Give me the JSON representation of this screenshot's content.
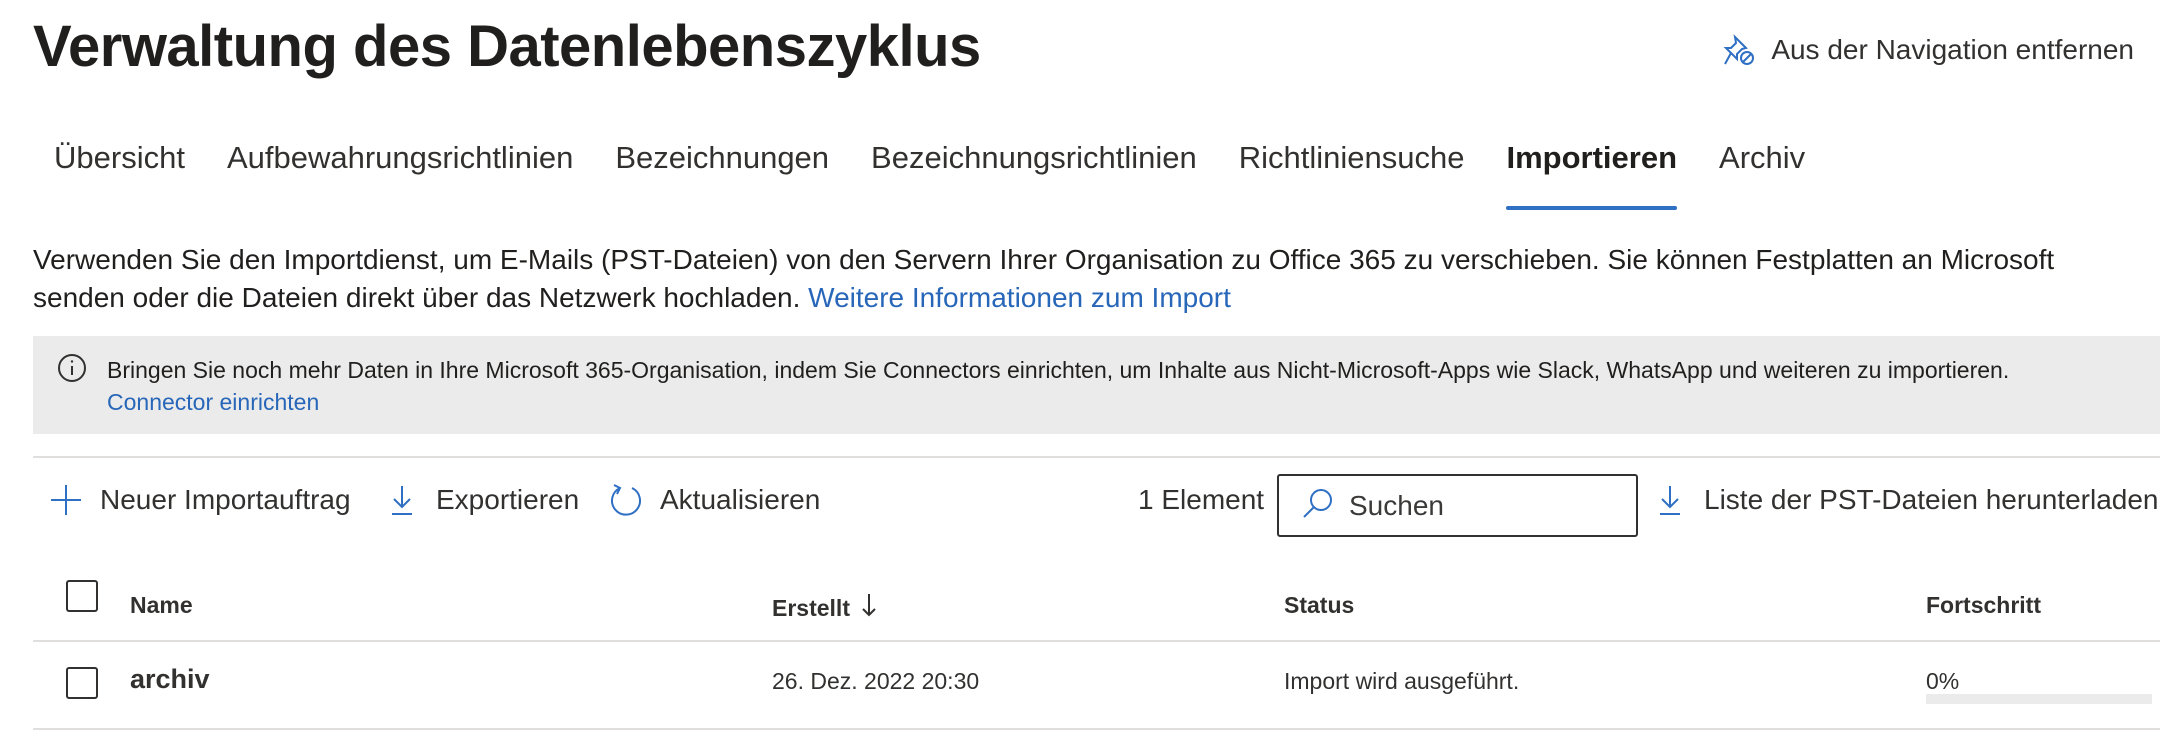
{
  "header": {
    "title": "Verwaltung des Datenlebenszyklus",
    "unpin_label": "Aus der Navigation entfernen"
  },
  "tabs": [
    {
      "label": "Übersicht",
      "active": false
    },
    {
      "label": "Aufbewahrungsrichtlinien",
      "active": false
    },
    {
      "label": "Bezeichnungen",
      "active": false
    },
    {
      "label": "Bezeichnungsrichtlinien",
      "active": false
    },
    {
      "label": "Richtliniensuche",
      "active": false
    },
    {
      "label": "Importieren",
      "active": true
    },
    {
      "label": "Archiv",
      "active": false
    }
  ],
  "intro": {
    "text": "Verwenden Sie den Importdienst, um E-Mails (PST-Dateien) von den Servern Ihrer Organisation zu Office 365 zu verschieben. Sie können Festplatten an Microsoft senden oder die Dateien direkt über das Netzwerk hochladen. ",
    "link": "Weitere Informationen zum Import"
  },
  "infobar": {
    "message": "Bringen Sie noch mehr Daten in Ihre Microsoft 365-Organisation, indem Sie Connectors einrichten, um Inhalte aus Nicht-Microsoft-Apps wie Slack, WhatsApp und weiteren zu importieren.",
    "link": "Connector einrichten"
  },
  "toolbar": {
    "new_label": "Neuer Importauftrag",
    "export_label": "Exportieren",
    "refresh_label": "Aktualisieren",
    "count_label": "1 Element",
    "search_placeholder": "Suchen",
    "download_label": "Liste der PST-Dateien herunterladen"
  },
  "table": {
    "columns": {
      "name": "Name",
      "created": "Erstellt",
      "status": "Status",
      "progress": "Fortschritt"
    },
    "rows": [
      {
        "name": "archiv",
        "created": "26. Dez. 2022 20:30",
        "status": "Import wird ausgeführt.",
        "progress_label": "0%",
        "progress": 0
      }
    ]
  },
  "colors": {
    "accent": "#2f6fc4",
    "link": "#2766b8",
    "infobar_bg": "#ebebeb"
  }
}
